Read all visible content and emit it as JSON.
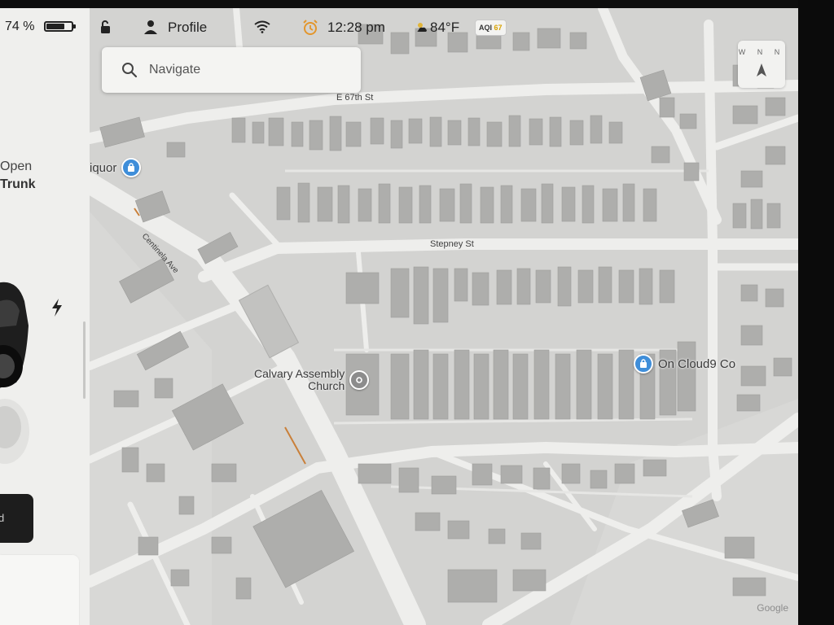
{
  "status": {
    "battery_percent": 74,
    "battery_label": "74 %",
    "profile_label": "Profile",
    "time": "12:28 pm",
    "temperature": "84°F",
    "aqi_label": "AQI",
    "aqi_value": "67"
  },
  "search": {
    "placeholder": "Navigate"
  },
  "compass": {
    "letters": "W N N"
  },
  "left_panel": {
    "trunk_action": "Open",
    "trunk_title": "Trunk",
    "bottom_button_label": "d"
  },
  "map": {
    "streets": {
      "e67": "E 67th St",
      "stepney": "Stepney St",
      "centinela": "Centinela Ave"
    },
    "pois": {
      "liquor": "iquor",
      "church_line1": "Calvary Assembly",
      "church_line2": "Church",
      "cloud9": "On Cloud9 Co"
    },
    "attribution": "Google"
  },
  "colors": {
    "map_background": "#d3d3d1",
    "road": "#eeeeec",
    "building": "#aeaeac",
    "poi_blue": "#3f8ed9",
    "alarm_orange": "#e3962c"
  }
}
